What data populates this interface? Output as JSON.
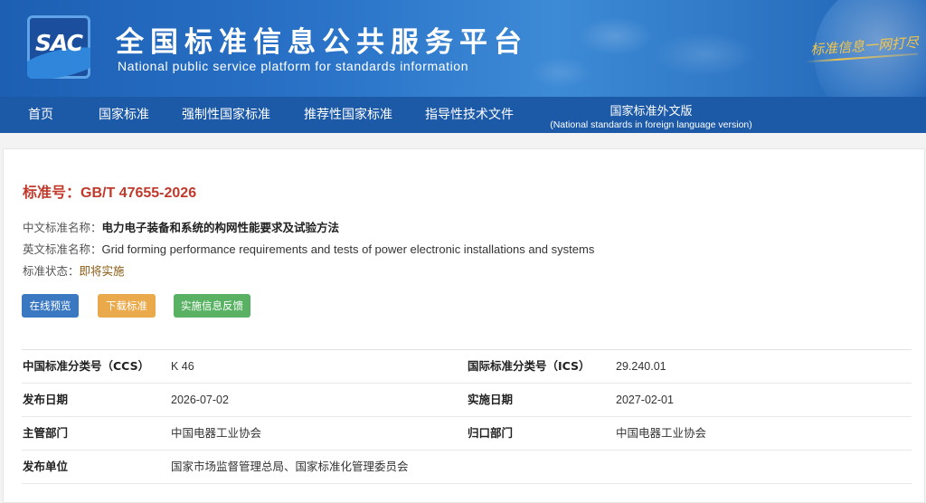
{
  "header": {
    "logo_text": "SAC",
    "title": "全国标准信息公共服务平台",
    "subtitle": "National public service platform  for standards information",
    "slogan": "标准信息一网打尽"
  },
  "nav": {
    "items": [
      {
        "label": "首页"
      },
      {
        "label": "国家标准"
      },
      {
        "label": "强制性国家标准"
      },
      {
        "label": "推荐性国家标准"
      },
      {
        "label": "指导性技术文件"
      }
    ],
    "foreign": {
      "label": "国家标准外文版",
      "sublabel": "(National standards in foreign language version)"
    }
  },
  "standard": {
    "number_label": "标准号：",
    "number": "GB/T 47655-2026",
    "cn_name_label": "中文标准名称：",
    "cn_name": "电力电子装备和系统的构网性能要求及试验方法",
    "en_name_label": "英文标准名称：",
    "en_name": "Grid forming performance requirements and tests of power electronic installations and systems",
    "status_label": "标准状态：",
    "status": "即将实施"
  },
  "actions": {
    "preview": "在线预览",
    "download": "下载标准",
    "feedback": "实施信息反馈"
  },
  "details": [
    {
      "label1": "中国标准分类号（CCS）",
      "value1": "K 46",
      "label2": "国际标准分类号（ICS）",
      "value2": "29.240.01"
    },
    {
      "label1": "发布日期",
      "value1": "2026-07-02",
      "label2": "实施日期",
      "value2": "2027-02-01"
    },
    {
      "label1": "主管部门",
      "value1": "中国电器工业协会",
      "label2": "归口部门",
      "value2": "中国电器工业协会"
    },
    {
      "label1": "发布单位",
      "value1": "国家市场监督管理总局、国家标准化管理委员会",
      "label2": "",
      "value2": ""
    }
  ]
}
